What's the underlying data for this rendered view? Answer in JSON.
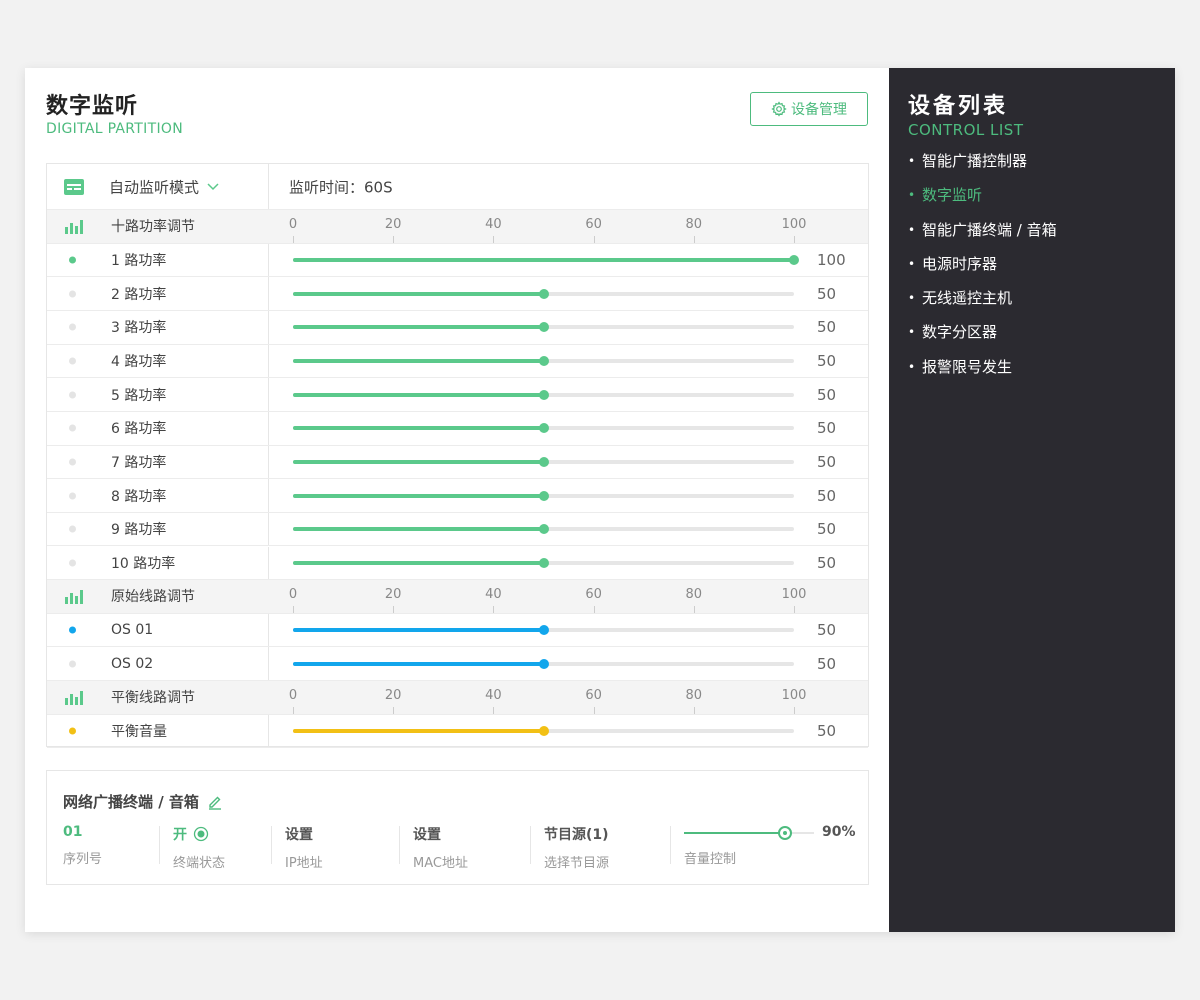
{
  "header": {
    "title": "数字监听",
    "subtitle": "DIGITAL PARTITION",
    "manage_button": "设备管理"
  },
  "monitor": {
    "mode_label": "自动监听模式",
    "time_label": "监听时间：60S"
  },
  "scale_ticks": [
    "0",
    "20",
    "40",
    "60",
    "80",
    "100"
  ],
  "sections": [
    {
      "title": "十路功率调节",
      "color": "#5bc98b",
      "rows": [
        {
          "label": "1 路功率",
          "value": 100,
          "value_text": "100",
          "active": true
        },
        {
          "label": "2 路功率",
          "value": 50,
          "value_text": "50",
          "active": false
        },
        {
          "label": "3 路功率",
          "value": 50,
          "value_text": "50",
          "active": false
        },
        {
          "label": "4 路功率",
          "value": 50,
          "value_text": "50",
          "active": false
        },
        {
          "label": "5 路功率",
          "value": 50,
          "value_text": "50",
          "active": false
        },
        {
          "label": "6 路功率",
          "value": 50,
          "value_text": "50",
          "active": false
        },
        {
          "label": "7 路功率",
          "value": 50,
          "value_text": "50",
          "active": false
        },
        {
          "label": "8 路功率",
          "value": 50,
          "value_text": "50",
          "active": false
        },
        {
          "label": "9 路功率",
          "value": 50,
          "value_text": "50",
          "active": false
        },
        {
          "label": "10 路功率",
          "value": 50,
          "value_text": "50",
          "active": false
        }
      ]
    },
    {
      "title": "原始线路调节",
      "color": "#12a6ec",
      "rows": [
        {
          "label": "OS 01",
          "value": 50,
          "value_text": "50",
          "active": true
        },
        {
          "label": "OS 02",
          "value": 50,
          "value_text": "50",
          "active": false
        }
      ]
    },
    {
      "title": "平衡线路调节",
      "color": "#f2c015",
      "rows": [
        {
          "label": "平衡音量",
          "value": 50,
          "value_text": "50",
          "active": true
        }
      ]
    }
  ],
  "terminal": {
    "title": "网络广播终端 / 音箱",
    "columns": [
      {
        "value": "01",
        "key": "序列号"
      },
      {
        "value": "开",
        "key": "终端状态"
      },
      {
        "value": "设置",
        "key": "IP地址"
      },
      {
        "value": "设置",
        "key": "MAC地址"
      },
      {
        "value": "节目源(1)",
        "key": "选择节目源"
      }
    ],
    "volume": {
      "value": 90,
      "value_text": "90%",
      "label": "音量控制"
    }
  },
  "sidebar": {
    "title": "设备列表",
    "subtitle": "CONTROL LIST",
    "items": [
      {
        "label": "智能广播控制器",
        "active": false
      },
      {
        "label": "数字监听",
        "active": true
      },
      {
        "label": "智能广播终端 / 音箱",
        "active": false
      },
      {
        "label": "电源时序器",
        "active": false
      },
      {
        "label": "无线遥控主机",
        "active": false
      },
      {
        "label": "数字分区器",
        "active": false
      },
      {
        "label": "报警限号发生",
        "active": false
      }
    ]
  },
  "colors": {
    "accent": "#4dbb7e",
    "sidebar_bg": "#2b2a30"
  }
}
